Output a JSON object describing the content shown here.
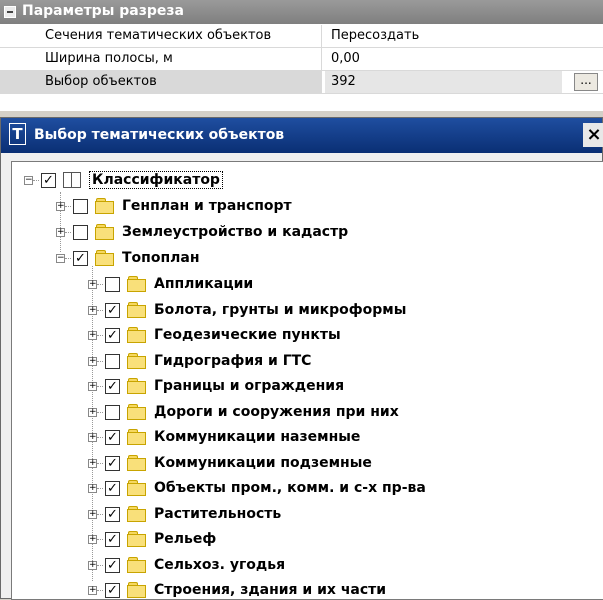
{
  "properties": {
    "section_title": "Параметры разреза",
    "rows": [
      {
        "name": "Сечения тематических объектов",
        "value": "Пересоздать"
      },
      {
        "name": "Ширина полосы, м",
        "value": "0,00"
      },
      {
        "name": "Выбор объектов",
        "value": "392",
        "button": "..."
      }
    ]
  },
  "panel": {
    "icon_letter": "T",
    "title": "Выбор тематических объектов",
    "close": "×"
  },
  "tree": {
    "root": {
      "label": "Классификатор",
      "checked": true
    },
    "groups": [
      {
        "label": "Генплан и транспорт",
        "checked": false
      },
      {
        "label": "Землеустройство и кадастр",
        "checked": false
      },
      {
        "label": "Топоплан",
        "checked": true
      }
    ],
    "items": [
      {
        "label": "Аппликации",
        "checked": false
      },
      {
        "label": "Болота, грунты и микроформы",
        "checked": true
      },
      {
        "label": "Геодезические пункты",
        "checked": true
      },
      {
        "label": "Гидрография и ГТС",
        "checked": false
      },
      {
        "label": "Границы и ограждения",
        "checked": true
      },
      {
        "label": "Дороги и сооружения при них",
        "checked": false
      },
      {
        "label": "Коммуникации наземные",
        "checked": true
      },
      {
        "label": "Коммуникации подземные",
        "checked": true
      },
      {
        "label": "Объекты пром., комм. и с-х пр-ва",
        "checked": true
      },
      {
        "label": "Растительность",
        "checked": true
      },
      {
        "label": "Рельеф",
        "checked": true
      },
      {
        "label": "Сельхоз. угодья",
        "checked": true
      },
      {
        "label": "Строения, здания и их части",
        "checked": true
      }
    ],
    "check_mark": "✓",
    "expand_sign": "+",
    "collapse_sign": "−"
  }
}
